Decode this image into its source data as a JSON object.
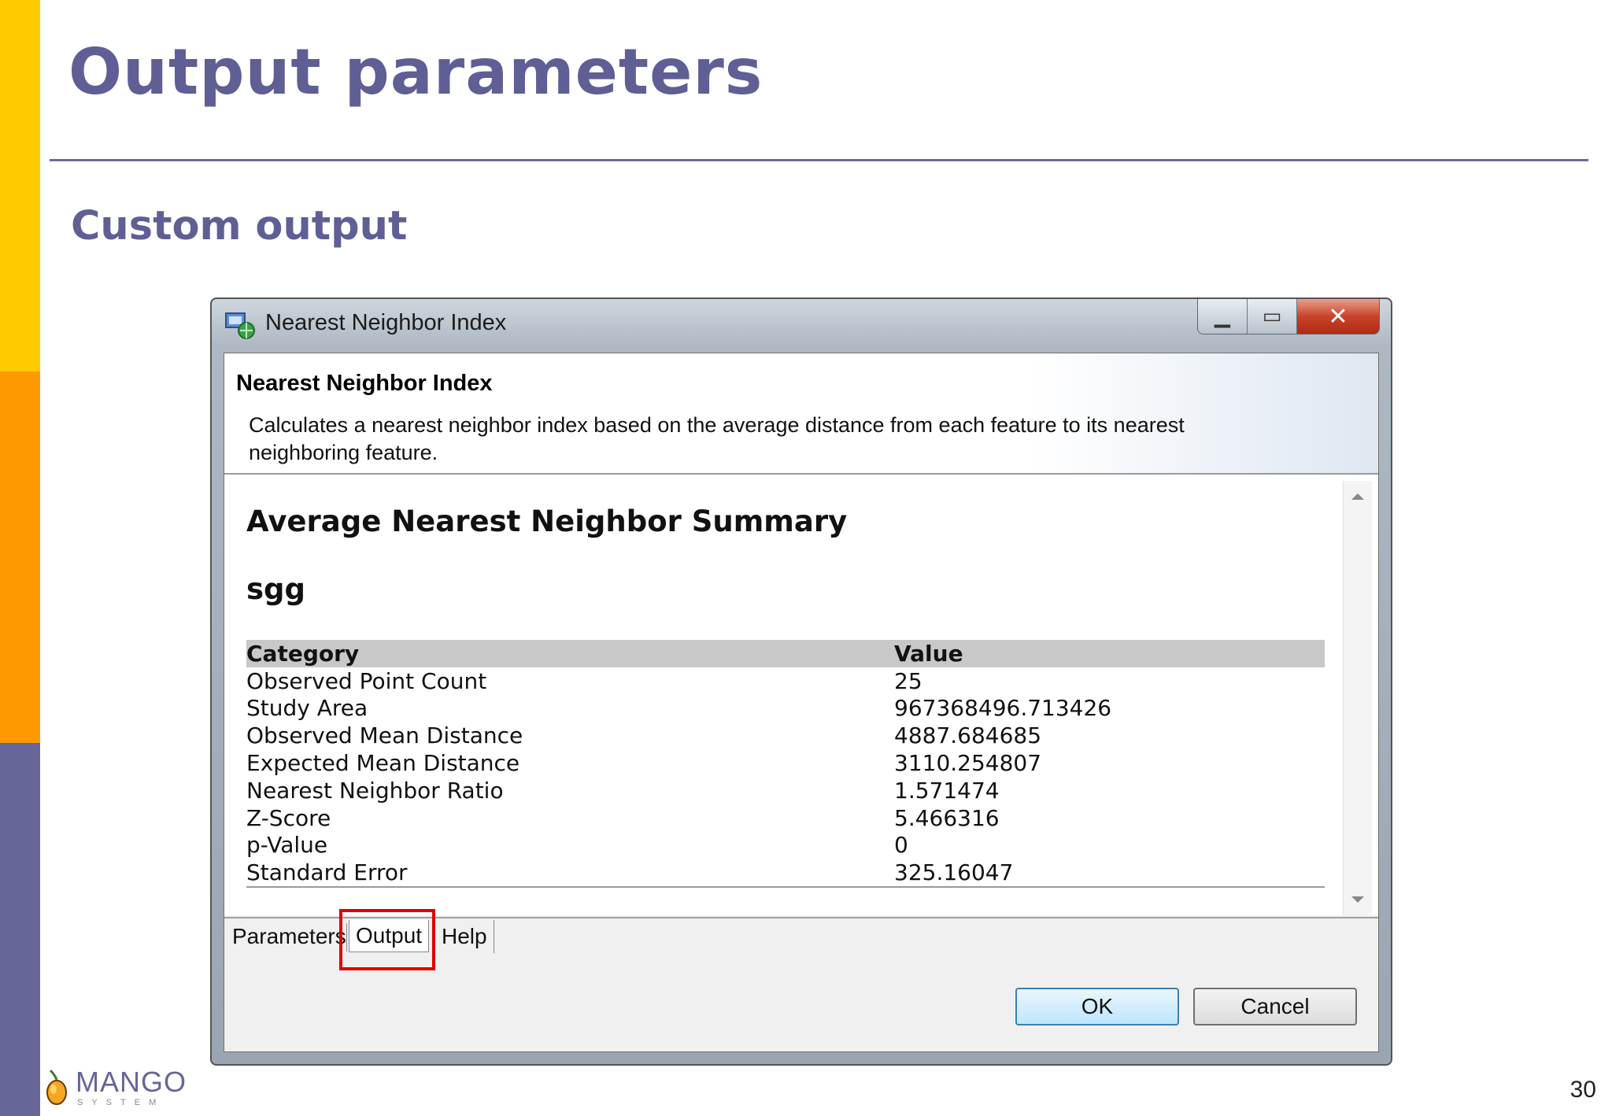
{
  "slide": {
    "title": "Output parameters",
    "subtitle": "Custom output",
    "page_number": "30",
    "bar_colors": [
      "#FFCC00",
      "#FF9900",
      "#666699"
    ]
  },
  "window": {
    "title": "Nearest Neighbor Index",
    "app_icon": "toolbox-globe-icon",
    "controls": {
      "minimize": "minimize-icon",
      "maximize": "maximize-icon",
      "close": "close-icon"
    }
  },
  "header": {
    "title": "Nearest Neighbor Index",
    "description": "Calculates a nearest neighbor index based on the average distance from each feature to its nearest neighboring feature."
  },
  "output": {
    "summary_title": "Average Nearest Neighbor Summary",
    "layer_name": "sgg",
    "table": {
      "columns": [
        "Category",
        "Value"
      ],
      "rows": [
        [
          "Observed Point Count",
          "25"
        ],
        [
          "Study Area",
          "967368496.713426"
        ],
        [
          "Observed Mean Distance",
          "4887.684685"
        ],
        [
          "Expected Mean Distance",
          "3110.254807"
        ],
        [
          "Nearest Neighbor Ratio",
          "1.571474"
        ],
        [
          "Z-Score",
          "5.466316"
        ],
        [
          "p-Value",
          "0"
        ],
        [
          "Standard Error",
          "325.16047"
        ]
      ]
    }
  },
  "tabs": {
    "parameters": "Parameters",
    "output": "Output",
    "help": "Help",
    "selected": "Output",
    "highlight_color": "#E00000"
  },
  "buttons": {
    "ok": "OK",
    "cancel": "Cancel"
  },
  "logo": {
    "name": "MANGO",
    "sub": "SYSTEM"
  }
}
